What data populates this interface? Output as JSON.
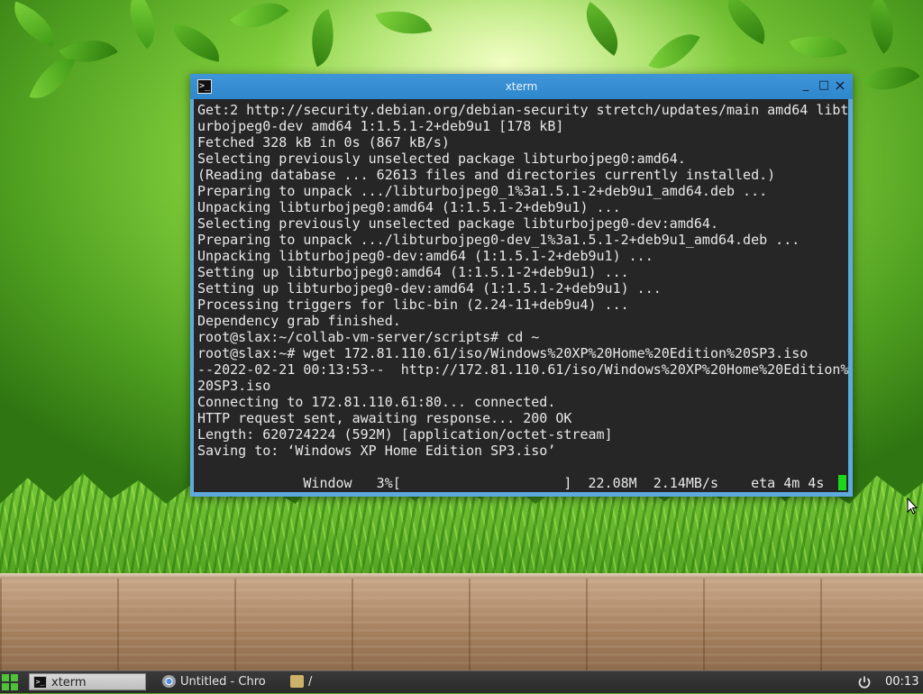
{
  "window": {
    "title": "xterm",
    "controls": {
      "minimize": "_",
      "maximize": "□",
      "close": "×"
    }
  },
  "terminal": {
    "lines": [
      "Get:2 http://security.debian.org/debian-security stretch/updates/main amd64 libt",
      "urbojpeg0-dev amd64 1:1.5.1-2+deb9u1 [178 kB]",
      "Fetched 328 kB in 0s (867 kB/s)",
      "Selecting previously unselected package libturbojpeg0:amd64.",
      "(Reading database ... 62613 files and directories currently installed.)",
      "Preparing to unpack .../libturbojpeg0_1%3a1.5.1-2+deb9u1_amd64.deb ...",
      "Unpacking libturbojpeg0:amd64 (1:1.5.1-2+deb9u1) ...",
      "Selecting previously unselected package libturbojpeg0-dev:amd64.",
      "Preparing to unpack .../libturbojpeg0-dev_1%3a1.5.1-2+deb9u1_amd64.deb ...",
      "Unpacking libturbojpeg0-dev:amd64 (1:1.5.1-2+deb9u1) ...",
      "Setting up libturbojpeg0:amd64 (1:1.5.1-2+deb9u1) ...",
      "Setting up libturbojpeg0-dev:amd64 (1:1.5.1-2+deb9u1) ...",
      "Processing triggers for libc-bin (2.24-11+deb9u4) ...",
      "Dependency grab finished.",
      "root@slax:~/collab-vm-server/scripts# cd ~",
      "root@slax:~# wget 172.81.110.61/iso/Windows%20XP%20Home%20Edition%20SP3.iso",
      "--2022-02-21 00:13:53--  http://172.81.110.61/iso/Windows%20XP%20Home%20Edition%",
      "20SP3.iso",
      "Connecting to 172.81.110.61:80... connected.",
      "HTTP request sent, awaiting response... 200 OK",
      "Length: 620724224 (592M) [application/octet-stream]",
      "Saving to: ‘Windows XP Home Edition SP3.iso’",
      "",
      "             Window   3%[                    ]  22.08M  2.14MB/s    eta 4m 4s"
    ],
    "progress_percent": 3,
    "cursor_color": "#1bd81b"
  },
  "taskbar": {
    "tasks": [
      {
        "label": "xterm",
        "icon": "terminal-icon",
        "active": true
      },
      {
        "label": "Untitled - Chro",
        "icon": "chrome-icon",
        "active": false
      },
      {
        "label": "/",
        "icon": "folder-icon",
        "active": false
      }
    ],
    "clock": "00:13"
  },
  "colors": {
    "titlebar": "#2f87cc",
    "terminal_bg": "#262626",
    "terminal_fg": "#e8e8e8",
    "taskbar": "#2a2a2a"
  }
}
